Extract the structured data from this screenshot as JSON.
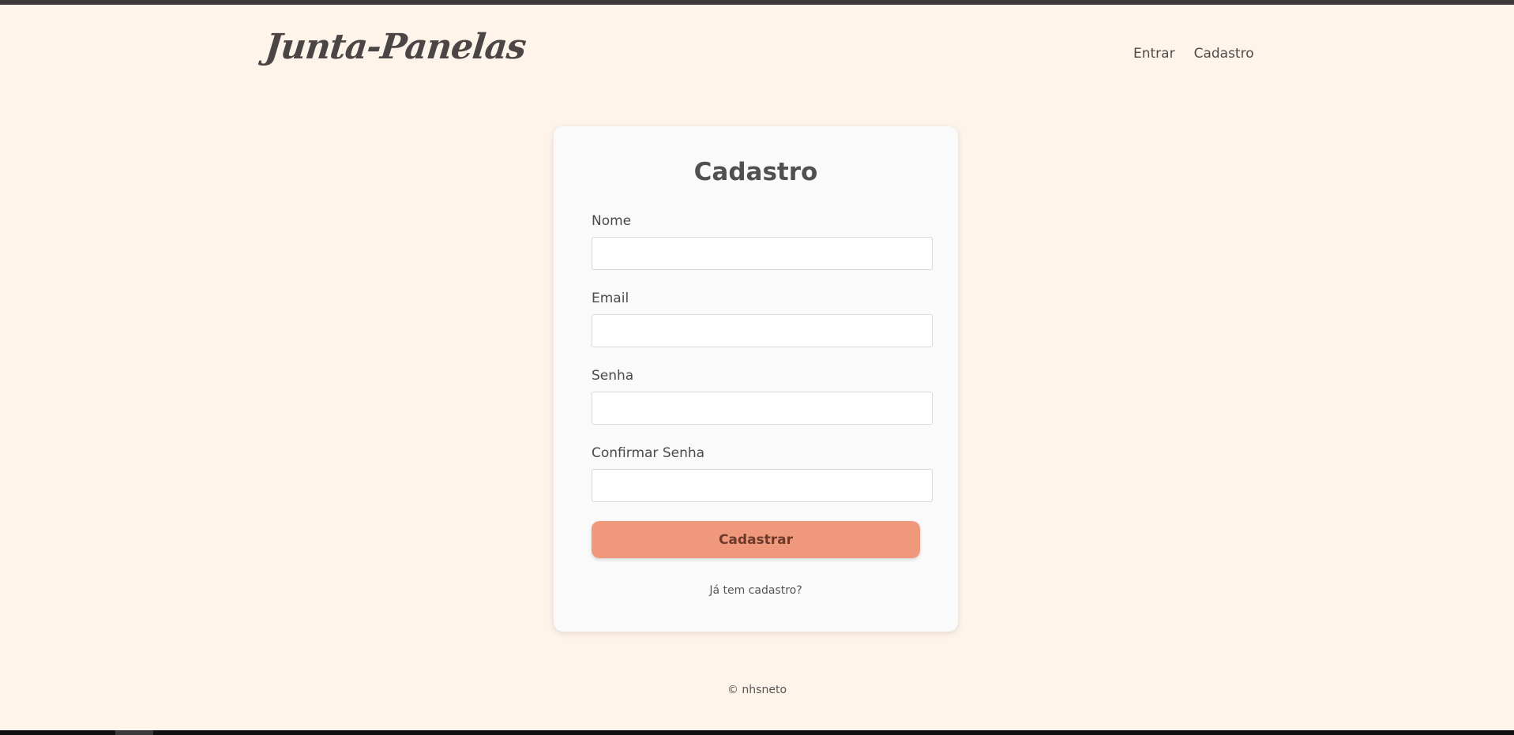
{
  "header": {
    "logo": "Junta-Panelas",
    "nav": [
      {
        "label": "Entrar"
      },
      {
        "label": "Cadastro"
      }
    ]
  },
  "form": {
    "title": "Cadastro",
    "fields": [
      {
        "label": "Nome",
        "value": "",
        "placeholder": ""
      },
      {
        "label": "Email",
        "value": "",
        "placeholder": ""
      },
      {
        "label": "Senha",
        "value": "",
        "placeholder": ""
      },
      {
        "label": "Confirmar Senha",
        "value": "",
        "placeholder": ""
      }
    ],
    "submit_label": "Cadastrar",
    "login_link": "Já tem cadastro?"
  },
  "footer": {
    "text": "© nhsneto"
  },
  "colors": {
    "background": "#fff4ea",
    "card": "#fafafa",
    "button": "#f0987b",
    "text": "#4a4a4a"
  }
}
